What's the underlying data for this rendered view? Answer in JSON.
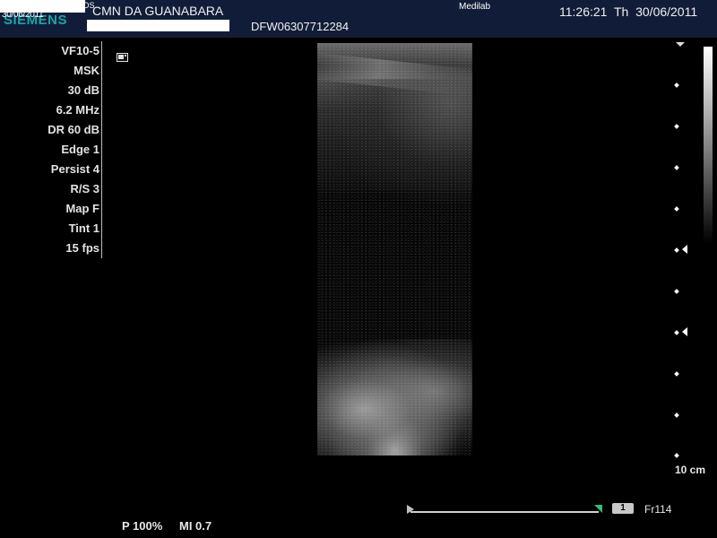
{
  "header": {
    "brand": "SIEMENS",
    "logo_date": "30/06/2011",
    "logo_suffix": "DS",
    "institution": "CMN DA GUANABARA",
    "patient_id": "DFW06307712284",
    "operator": "Medilab",
    "datetime": "11:26:21  Th  30/06/2011",
    "brand_color": "#18a6a8",
    "header_bg": "#111d38"
  },
  "params": [
    "VF10-5",
    "MSK",
    "30 dB",
    "6.2 MHz",
    "DR 60 dB",
    "Edge 1",
    "Persist 4",
    "R/S 3",
    "Map F",
    "Tint 1",
    "15 fps"
  ],
  "icons": {
    "freeze_icon": "fullscreen-icon"
  },
  "scale": {
    "depth_label": "10 cm"
  },
  "bottom": {
    "power": "P 100%",
    "mi": "MI 0.7",
    "cine_frame_box": "1",
    "frame_label": "Fr114"
  }
}
